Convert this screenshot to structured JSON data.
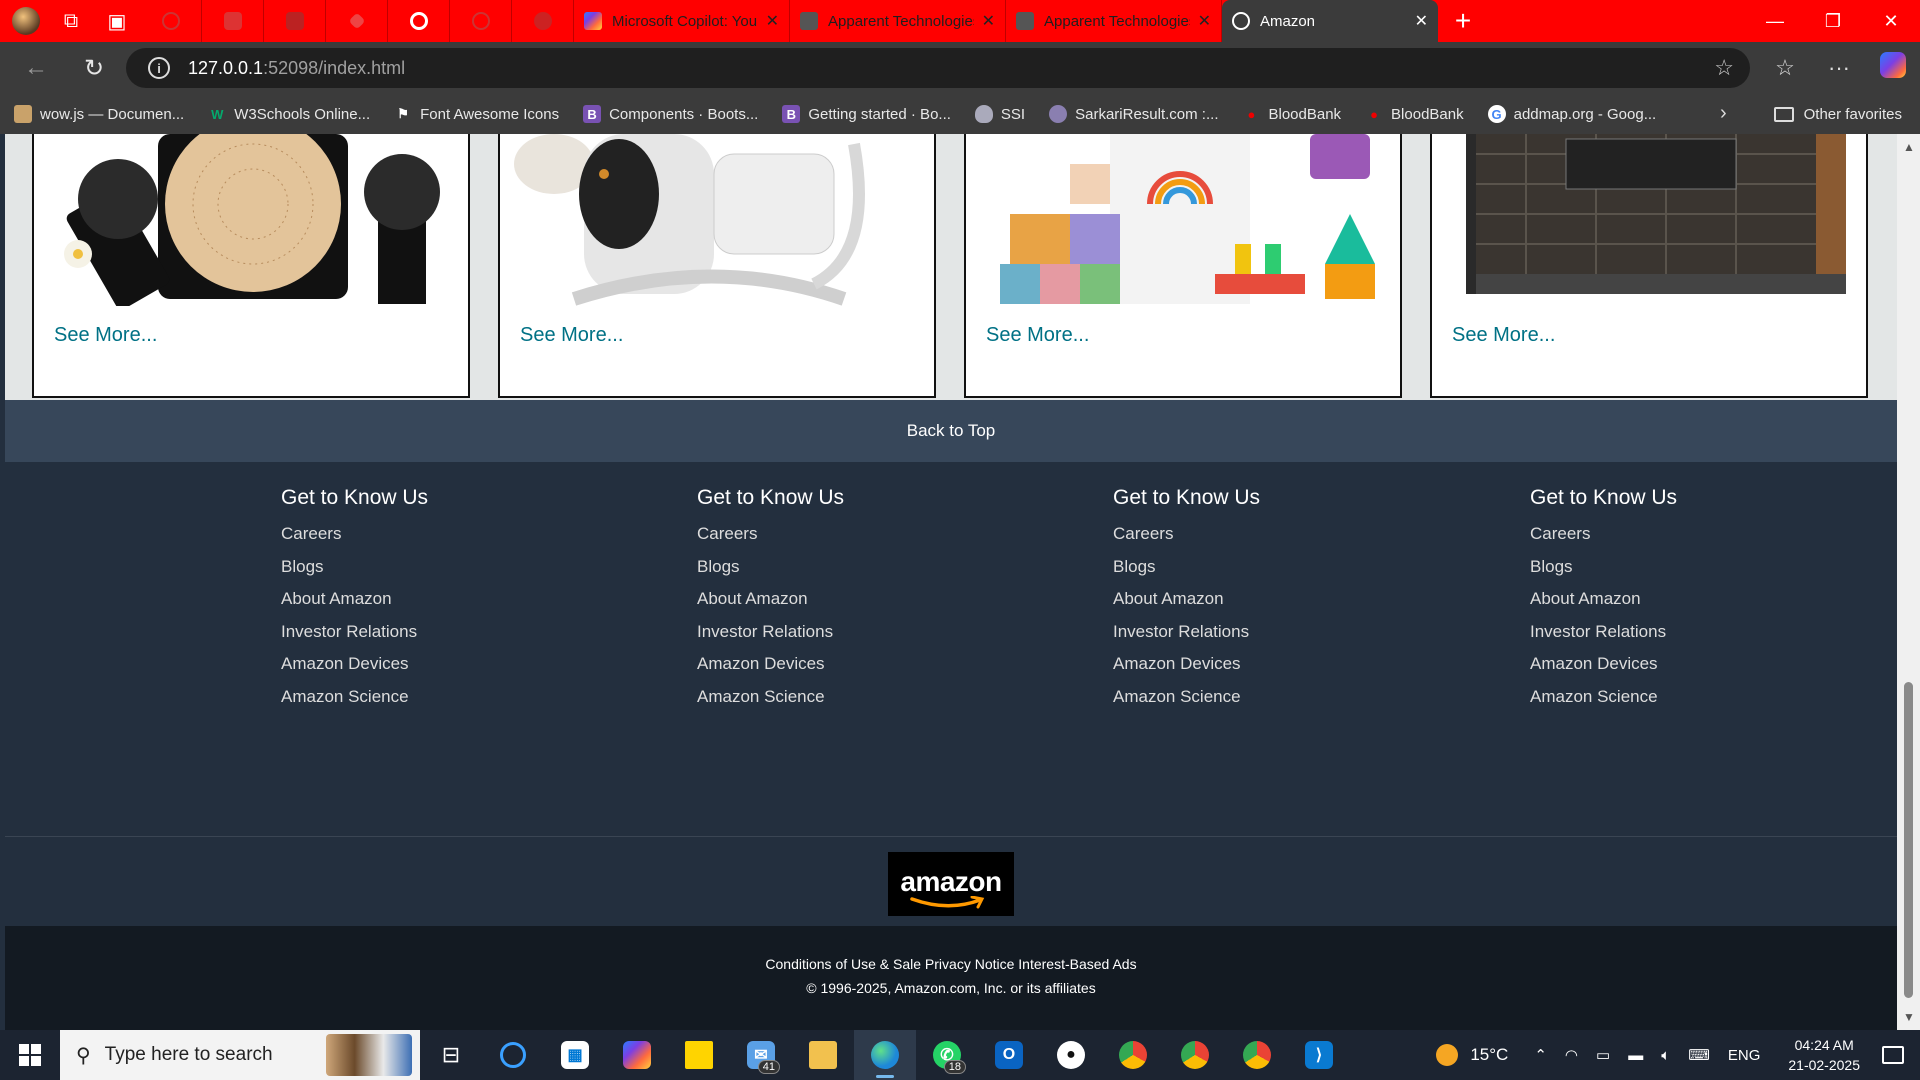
{
  "browser": {
    "tabs": [
      {
        "title": "Microsoft Copilot: Your AI co",
        "favicon": "copilot-icon"
      },
      {
        "title": "Apparent Technologies",
        "favicon": "cube-icon"
      },
      {
        "title": "Apparent Technologies",
        "favicon": "cube-icon"
      },
      {
        "title": "Amazon",
        "favicon": "globe-icon",
        "active": true
      }
    ],
    "address": {
      "host": "127.0.0.1",
      "path": ":52098/index.html"
    },
    "bookmarks": [
      "wow.js — Documen...",
      "W3Schools Online...",
      "Font Awesome Icons",
      "Components · Boots...",
      "Getting started · Bo...",
      "SSI",
      "SarkariResult.com :...",
      "BloodBank",
      "BloodBank",
      "addmap.org - Goog..."
    ],
    "other_favorites": "Other favorites"
  },
  "page": {
    "cards": [
      {
        "link": "See More..."
      },
      {
        "link": "See More..."
      },
      {
        "link": "See More..."
      },
      {
        "link": "See More..."
      }
    ],
    "back_to_top": "Back to Top",
    "footer_columns": [
      {
        "heading": "Get to Know Us",
        "links": [
          "Careers",
          "Blogs",
          "About Amazon",
          "Investor Relations",
          "Amazon Devices",
          "Amazon Science"
        ]
      },
      {
        "heading": "Get to Know Us",
        "links": [
          "Careers",
          "Blogs",
          "About Amazon",
          "Investor Relations",
          "Amazon Devices",
          "Amazon Science"
        ]
      },
      {
        "heading": "Get to Know Us",
        "links": [
          "Careers",
          "Blogs",
          "About Amazon",
          "Investor Relations",
          "Amazon Devices",
          "Amazon Science"
        ]
      },
      {
        "heading": "Get to Know Us",
        "links": [
          "Careers",
          "Blogs",
          "About Amazon",
          "Investor Relations",
          "Amazon Devices",
          "Amazon Science"
        ]
      }
    ],
    "logo_text": "amazon",
    "legal_links": "Conditions of Use & Sale Privacy Notice Interest-Based Ads",
    "copyright": "© 1996-2025, Amazon.com, Inc. or its affiliates",
    "colors": {
      "link": "#007185",
      "footer_bg": "#232f3e",
      "back_to_top_bg": "#37475a",
      "legal_bg": "#131a22",
      "logo_smile": "#ff9900"
    }
  },
  "taskbar": {
    "search_placeholder": "Type here to search",
    "badges": {
      "mail": "41",
      "whatsapp": "18"
    },
    "weather": "15°C",
    "language": "ENG",
    "time": "04:24 AM",
    "date": "21-02-2025"
  }
}
